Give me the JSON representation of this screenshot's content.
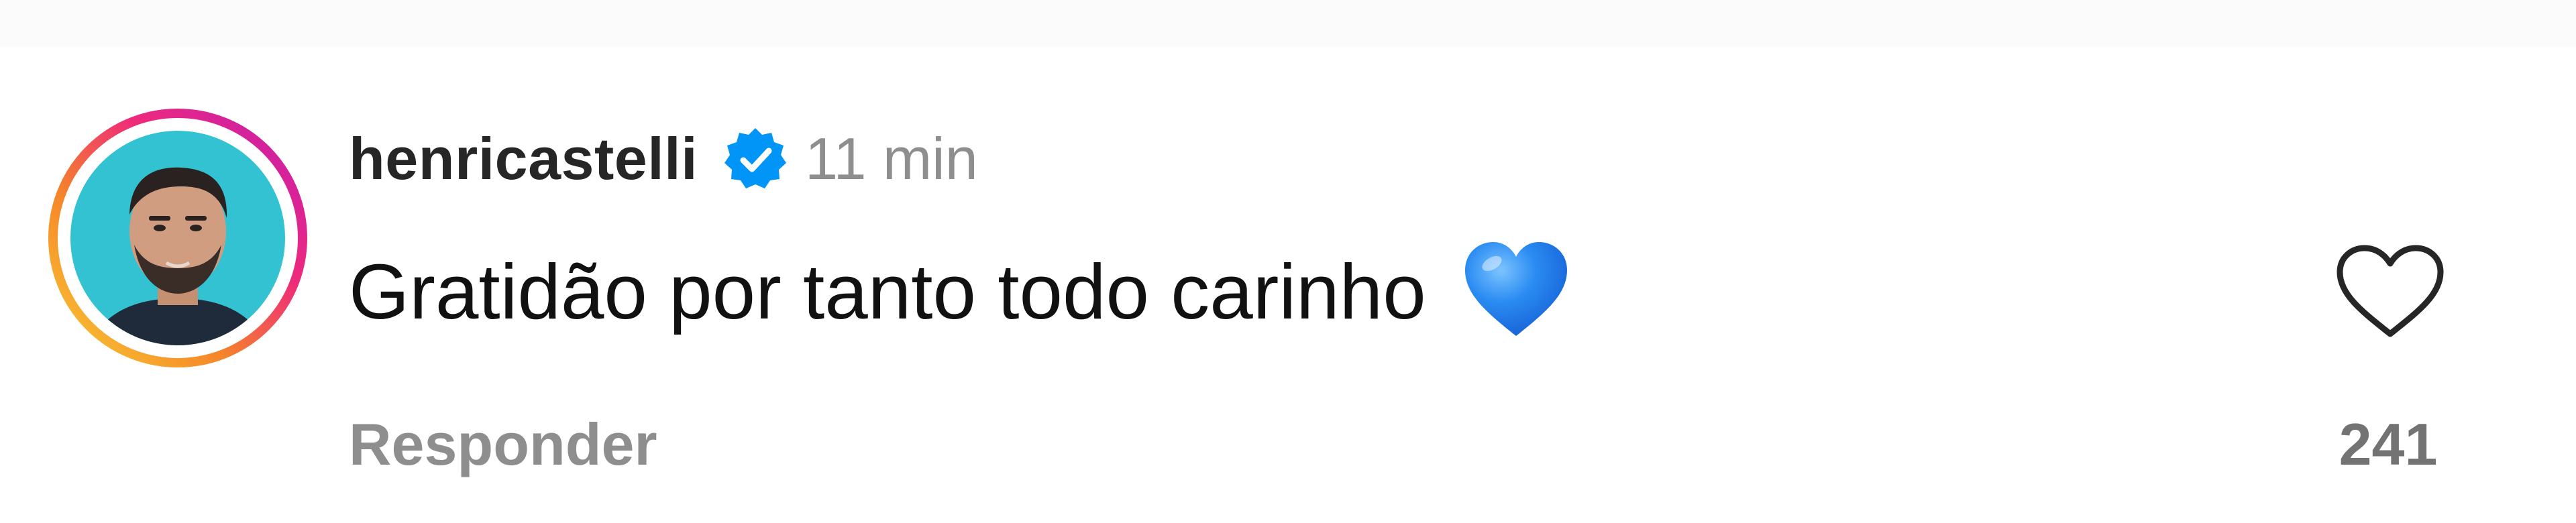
{
  "comment": {
    "username": "henricastelli",
    "verified": true,
    "timestamp": "11 min",
    "text": "Gratidão por tanto todo carinho",
    "emoji": "blue-heart",
    "reply_label": "Responder",
    "like_count": "241"
  },
  "colors": {
    "verified_badge": "#0095f6",
    "emoji_heart": "#1e7df0",
    "story_ring_start": "#f9ce34",
    "story_ring_mid": "#ee2a7b",
    "story_ring_end": "#c21cb5",
    "avatar_background": "#33c2d2",
    "muted_text": "#8e8e8e"
  }
}
